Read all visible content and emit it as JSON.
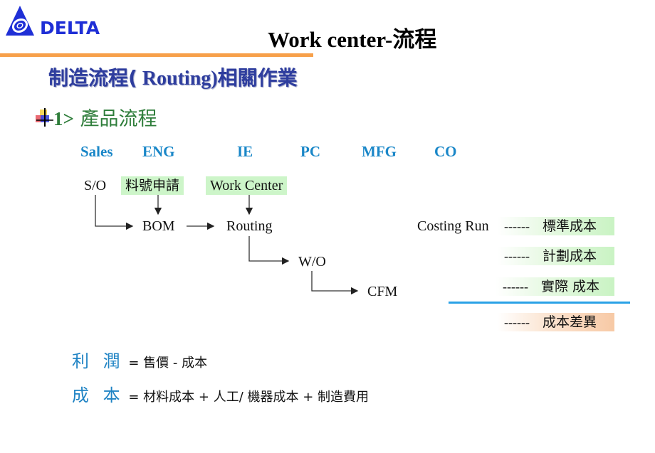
{
  "logo": {
    "brand": "DELTA",
    "color": "#1f2fd6"
  },
  "title": "Work center-流程",
  "subtitle": {
    "cjk_prefix": "制造流程(",
    "latin": " Routing)",
    "cjk_suffix": "相關作業"
  },
  "step": {
    "number": "1>",
    "label": "產品流程"
  },
  "departments": [
    "Sales",
    "ENG",
    "IE",
    "PC",
    "MFG",
    "CO"
  ],
  "flow": {
    "so": "S/O",
    "part_request": "料號申請",
    "work_center": "Work Center",
    "bom": "BOM",
    "routing": "Routing",
    "wo": "W/O",
    "cfm": "CFM",
    "costing_run": "Costing Run"
  },
  "costs": [
    {
      "dash": "------",
      "label": "標準成本",
      "style": "green"
    },
    {
      "dash": "------",
      "label": "計劃成本",
      "style": "green"
    },
    {
      "dash": "------",
      "label": "實際 成本",
      "style": "green"
    },
    {
      "dash": "------",
      "label": "成本差異",
      "style": "orange"
    }
  ],
  "formulas": [
    {
      "term": "利 潤",
      "expr": "= 售價 - 成本"
    },
    {
      "term": "成 本",
      "expr": "= 材料成本 + 人工/ 機器成本 + 制造費用"
    }
  ],
  "colors": {
    "title_rule": "#f7a04a",
    "subtitle": "#2e3d9e",
    "step": "#2e7d3a",
    "department": "#1a87c8",
    "tag_green": "#cdf5c9",
    "tag_orange": "#f7c9a5",
    "divider_blue": "#2aa2e6"
  }
}
